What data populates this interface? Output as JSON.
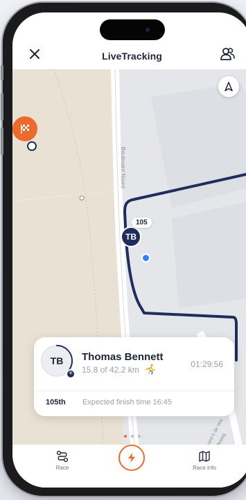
{
  "header": {
    "title": "LiveTracking"
  },
  "map": {
    "street_label": "Boulevard Noord",
    "street_label_2": "Boulevard Ir de Vos",
    "street_label_3": "van Kralleweg"
  },
  "runner_marker": {
    "initials": "TB",
    "bib": "105"
  },
  "card": {
    "avatar_initials": "TB",
    "name": "Thomas Bennett",
    "progress": "15.8 of 42.2 km",
    "progress_fraction": 0.374,
    "elapsed": "01:29:56",
    "position": "105th",
    "expected_finish": "Expected finish time 16:45"
  },
  "pager": {
    "pages": 3,
    "active": 0
  },
  "bottom_nav": {
    "race_label": "Race",
    "race_info_label": "Race info"
  },
  "icons": {
    "close": "close-icon",
    "users": "users-icon",
    "compass": "navigation-arrow-icon",
    "finish": "checkered-flag-icon",
    "runner": "running-person-icon",
    "route": "route-icon",
    "bolt": "lightning-bolt-icon",
    "map": "map-icon"
  },
  "colors": {
    "accent": "#ec6a2b",
    "route": "#1f2d5c",
    "location": "#2f80ff"
  }
}
